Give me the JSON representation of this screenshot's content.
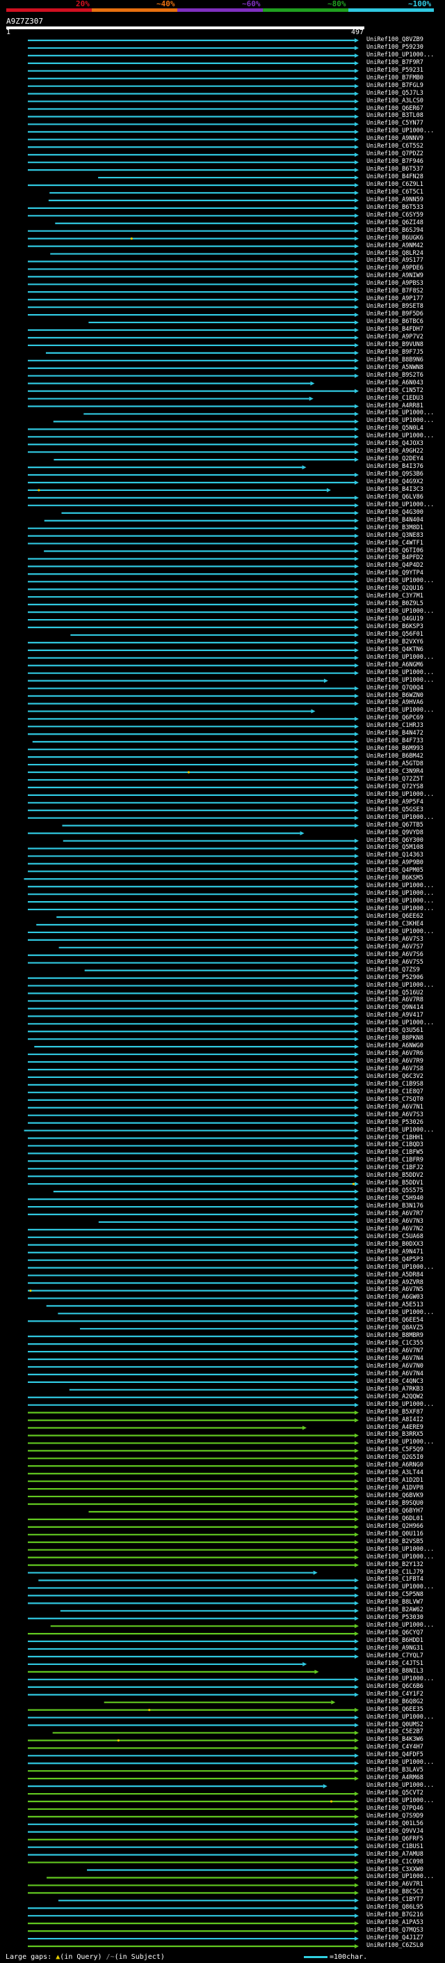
{
  "chart_data": {
    "type": "alignment-overview",
    "query_id": "A9Z7Z307",
    "query_start": 1,
    "query_end": 497,
    "identity_scale": {
      "labels": [
        "20%",
        "~40%",
        "~60%",
        "~80%",
        "~100%"
      ],
      "colors": [
        "#d01020",
        "#e87010",
        "#8030c0",
        "#20a020",
        "#30c8e0"
      ]
    },
    "series_colors": {
      "high": "#30c8e0",
      "mid": "#62c820",
      "dark": "#000000"
    },
    "hits": [
      "UniRef100_Q8VZB9",
      "UniRef100_P59230",
      "UniRef100_UP1000...",
      "UniRef100_B7F9R7",
      "UniRef100_P59231",
      "UniRef100_B7FMB0",
      "UniRef100_B7FGL9",
      "UniRef100_Q5J7L3",
      "UniRef100_A3LCS0",
      "UniRef100_Q6ER67",
      "UniRef100_B3TL08",
      "UniRef100_C5YN77",
      "UniRef100_UP1000...",
      "UniRef100_A9NNV9",
      "UniRef100_C6T5S2",
      "UniRef100_Q7PDZ2",
      "UniRef100_B7F946",
      "UniRef100_B6T537",
      "UniRef100_B4FN28",
      "UniRef100_C6Z9L1",
      "UniRef100_C6T5C1",
      "UniRef100_A9NN59",
      "UniRef100_B6T533",
      "UniRef100_C6SY59",
      "UniRef100_Q6ZI48",
      "UniRef100_B6SJ94",
      "UniRef100_B6UGK6",
      "UniRef100_A9NM42",
      "UniRef100_Q8LR24",
      "UniRef100_A9S177",
      "UniRef100_A9PDE6",
      "UniRef100_A9NIW9",
      "UniRef100_A9PBS3",
      "UniRef100_B7F8S2",
      "UniRef100_A9P177",
      "UniRef100_B9SET8",
      "UniRef100_B9F5D6",
      "UniRef100_B6TBC6",
      "UniRef100_B4FDH7",
      "UniRef100_A9P7V2",
      "UniRef100_B9VUN8",
      "UniRef100_B9F7J5",
      "UniRef100_B8B9N6",
      "UniRef100_A5NWN8",
      "UniRef100_B9S2T6",
      "UniRef100_A6N043",
      "UniRef100_C1N5T2",
      "UniRef100_C1EDU3",
      "UniRef100_A4RR81",
      "UniRef100_UP1000...",
      "UniRef100_UP1000...",
      "UniRef100_Q5N0L4",
      "UniRef100_UP1000...",
      "UniRef100_Q4JOX3",
      "UniRef100_A9GH22",
      "UniRef100_Q2DEY4",
      "UniRef100_B4I376",
      "UniRef100_Q9S3B6",
      "UniRef100_Q4G9X2",
      "UniRef100_B4I3C3",
      "UniRef100_Q6LV86",
      "UniRef100_UP1000...",
      "UniRef100_Q4G300",
      "UniRef100_B4N404",
      "UniRef100_B3M8D1",
      "UniRef100_Q3NE83",
      "UniRef100_C4WTF1",
      "UniRef100_Q6TI06",
      "UniRef100_B4PFD2",
      "UniRef100_Q4P4D2",
      "UniRef100_Q9YTP4",
      "UniRef100_UP1000...",
      "UniRef100_Q2QU16",
      "UniRef100_C3Y7M1",
      "UniRef100_B0Z9L5",
      "UniRef100_UP1000...",
      "UniRef100_Q4GU19",
      "UniRef100_B6KSP3",
      "UniRef100_Q56F01",
      "UniRef100_B2VXY6",
      "UniRef100_Q4KTN6",
      "UniRef100_UP1000...",
      "UniRef100_A6NGM6",
      "UniRef100_UP1000...",
      "UniRef100_UP1000...",
      "UniRef100_Q7Q0Q4",
      "UniRef100_B6WZN0",
      "UniRef100_A9HVA6",
      "UniRef100_UP1000...",
      "UniRef100_Q6PC69",
      "UniRef100_C1HRJ3",
      "UniRef100_B4N472",
      "UniRef100_B4F733",
      "UniRef100_B6M993",
      "UniRef100_B6BM42",
      "UniRef100_A5GTD8",
      "UniRef100_C3N9R4",
      "UniRef100_Q72Z5T",
      "UniRef100_Q72YS8",
      "UniRef100_UP1000...",
      "UniRef100_A9P5F4",
      "UniRef100_Q5GSE3",
      "UniRef100_UP1000...",
      "UniRef100_Q67TB5",
      "UniRef100_Q9VYD8",
      "UniRef100_Q6Y300",
      "UniRef100_Q5M108",
      "UniRef100_Q14363",
      "UniRef100_A9P9B0",
      "UniRef100_Q4PM05",
      "UniRef100_B6KSM5",
      "UniRef100_UP1000...",
      "UniRef100_UP1000...",
      "UniRef100_UP1000...",
      "UniRef100_UP1000...",
      "UniRef100_Q6EE62",
      "UniRef100_C3KHE4",
      "UniRef100_UP1000...",
      "UniRef100_A6V7S3",
      "UniRef100_A6V7S7",
      "UniRef100_A6V7S6",
      "UniRef100_A6V7S5",
      "UniRef100_Q7ZS9",
      "UniRef100_P52906",
      "UniRef100_UP1000...",
      "UniRef100_Q516U2",
      "UniRef100_A6V7R8",
      "UniRef100_Q9N414",
      "UniRef100_A9V417",
      "UniRef100_UP1000...",
      "UniRef100_Q3U561",
      "UniRef100_B8PKN8",
      "UniRef100_A6NWG0",
      "UniRef100_A6V7R6",
      "UniRef100_A6V7R9",
      "UniRef100_A6V7S8",
      "UniRef100_Q6C3V2",
      "UniRef100_C1B9S8",
      "UniRef100_C1E8Q7",
      "UniRef100_C7SQT0",
      "UniRef100_A6V7N1",
      "UniRef100_A6V7S3",
      "UniRef100_P53026",
      "UniRef100_UP1000...",
      "UniRef100_C1BHH1",
      "UniRef100_C1BQD3",
      "UniRef100_C1BFW5",
      "UniRef100_C1BFR9",
      "UniRef100_C1BFJ2",
      "UniRef100_B5DDV2",
      "UniRef100_B5DDV1",
      "UniRef100_Q5S575",
      "UniRef100_C5H940",
      "UniRef100_B3N176",
      "UniRef100_A6V7R7",
      "UniRef100_A6V7N3",
      "UniRef100_A6V7N2",
      "UniRef100_C5UA68",
      "UniRef100_B0DXX3",
      "UniRef100_A9N471",
      "UniRef100_Q4P5P3",
      "UniRef100_UP1000...",
      "UniRef100_A5DR84",
      "UniRef100_A9ZVR8",
      "UniRef100_A6V7N5",
      "UniRef100_A6GW03",
      "UniRef100_A5E513",
      "UniRef100_UP1000...",
      "UniRef100_Q6EE54",
      "UniRef100_Q8AVZ5",
      "UniRef100_B8MBR9",
      "UniRef100_C1C355",
      "UniRef100_A6V7N7",
      "UniRef100_A6V7N4",
      "UniRef100_A6V7N0",
      "UniRef100_A6V7N4",
      "UniRef100_C4QNC3",
      "UniRef100_A7RKB3",
      "UniRef100_A2QQW2",
      "UniRef100_UP1000...",
      "UniRef100_B5XF87",
      "UniRef100_A8I4I2",
      "UniRef100_A4ERE9",
      "UniRef100_B3RRX5",
      "UniRef100_UP1000...",
      "UniRef100_C5F5Q9",
      "UniRef100_Q2G5I0",
      "UniRef100_A6RNG0",
      "UniRef100_A3LT44",
      "UniRef100_A1D2D1",
      "UniRef100_A1DVP8",
      "UniRef100_Q6BVK9",
      "UniRef100_B9SQU0",
      "UniRef100_Q6BYH7",
      "UniRef100_Q6DL01",
      "UniRef100_Q2H966",
      "UniRef100_Q0U116",
      "UniRef100_B2VSB5",
      "UniRef100_UP1000...",
      "UniRef100_UP1000...",
      "UniRef100_B2Y132",
      "UniRef100_C1LJ79",
      "UniRef100_C1FBT4",
      "UniRef100_UP1000...",
      "UniRef100_C5P5N8",
      "UniRef100_B8LVW7",
      "UniRef100_B2AW62",
      "UniRef100_P53030",
      "UniRef100_UP1000...",
      "UniRef100_Q6CYQ7",
      "UniRef100_B6HDD1",
      "UniRef100_A9NG31",
      "UniRef100_C7YQL7",
      "UniRef100_C4JTS1",
      "UniRef100_B8NIL3",
      "UniRef100_UP1000...",
      "UniRef100_Q6C6B6",
      "UniRef100_C4Y1F2",
      "UniRef100_B6Q8G2",
      "UniRef100_Q6EE35",
      "UniRef100_UP1000...",
      "UniRef100_Q0UMS2",
      "UniRef100_C5E2B7",
      "UniRef100_B4K3W6",
      "UniRef100_C4Y4H7",
      "UniRef100_Q4FDF5",
      "UniRef100_UP1000...",
      "UniRef100_B3LAV5",
      "UniRef100_A4RM68",
      "UniRef100_UP1000...",
      "UniRef100_Q5CVT2",
      "UniRef100_UP1000...",
      "UniRef100_Q7PQ46",
      "UniRef100_Q7S9D9",
      "UniRef100_Q01L56",
      "UniRef100_Q9VVJ4",
      "UniRef100_Q6FRF5",
      "UniRef100_C1BUS1",
      "UniRef100_A7AMU8",
      "UniRef100_C1C098",
      "UniRef100_C3XXW0",
      "UniRef100_UP1000...",
      "UniRef100_A6V7R1",
      "UniRef100_B8C5C3",
      "UniRef100_C1BYT7",
      "UniRef100_Q86L95",
      "UniRef100_B7G216",
      "UniRef100_A1PA53",
      "UniRef100_Q7MQS3",
      "UniRef100_Q4J1Z7",
      "UniRef100_C6ZSL0"
    ]
  },
  "footer": {
    "gaps_label": "Large gaps:",
    "gap_query_marker": "▲",
    "gap_query_text": "(in Query)",
    "gap_subject_marker": "/~",
    "gap_subject_text": "(in Subject)",
    "char_legend_text": "=100char."
  }
}
